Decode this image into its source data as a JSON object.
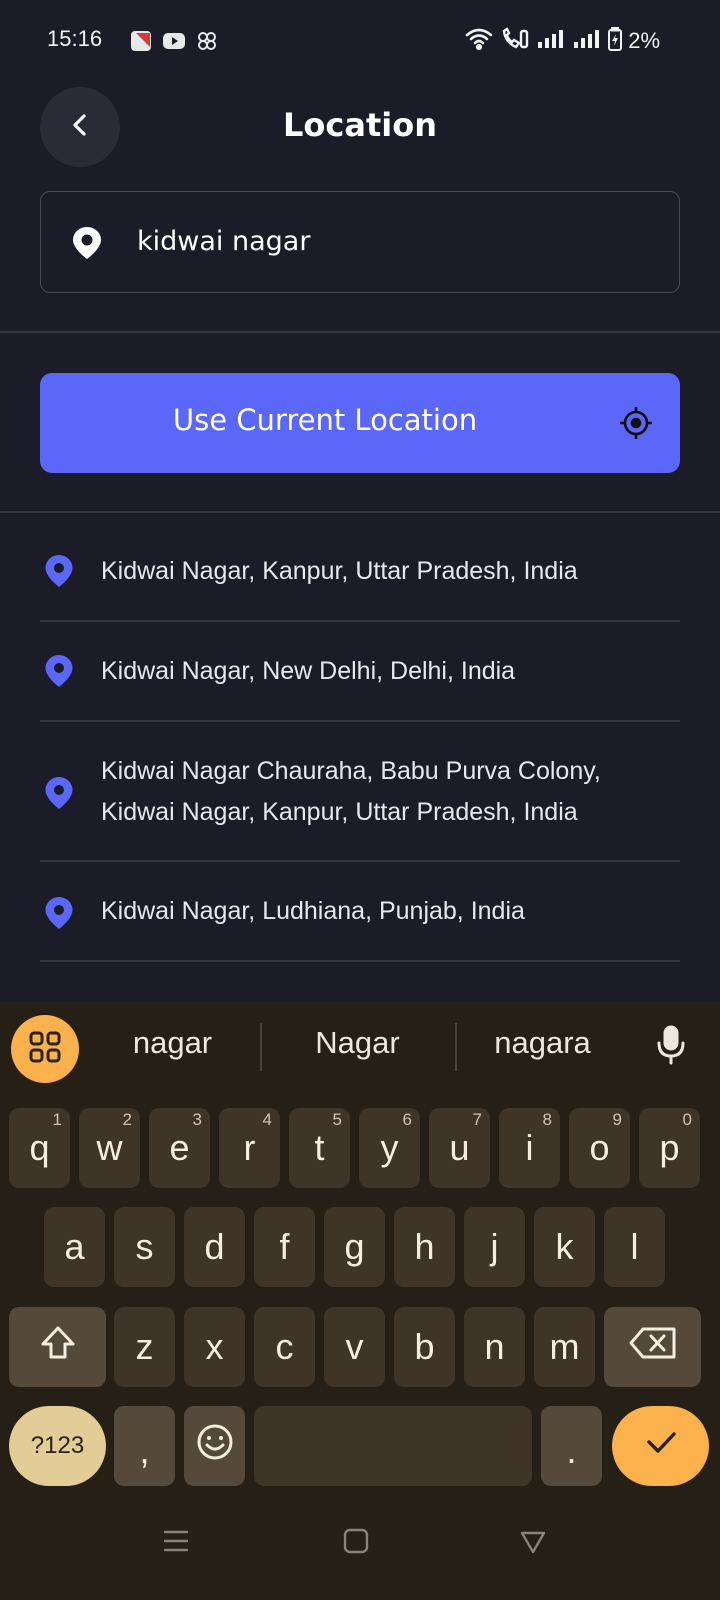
{
  "status_bar": {
    "time": "15:16",
    "battery": "2%"
  },
  "header": {
    "title": "Location"
  },
  "search": {
    "value": "kidwai nagar"
  },
  "current_location_button": {
    "label": "Use Current Location"
  },
  "results": [
    {
      "lines": [
        "Kidwai Nagar, Kanpur, Uttar Pradesh, India"
      ]
    },
    {
      "lines": [
        "Kidwai Nagar, New Delhi, Delhi, India"
      ]
    },
    {
      "lines": [
        "Kidwai Nagar Chauraha, Babu Purva Colony,",
        "Kidwai Nagar, Kanpur, Uttar Pradesh, India"
      ]
    },
    {
      "lines": [
        "Kidwai Nagar, Ludhiana, Punjab, India"
      ]
    }
  ],
  "keyboard": {
    "suggestions": [
      "nagar",
      "Nagar",
      "nagara"
    ],
    "row1": [
      {
        "k": "q",
        "h": "1"
      },
      {
        "k": "w",
        "h": "2"
      },
      {
        "k": "e",
        "h": "3"
      },
      {
        "k": "r",
        "h": "4"
      },
      {
        "k": "t",
        "h": "5"
      },
      {
        "k": "y",
        "h": "6"
      },
      {
        "k": "u",
        "h": "7"
      },
      {
        "k": "i",
        "h": "8"
      },
      {
        "k": "o",
        "h": "9"
      },
      {
        "k": "p",
        "h": "0"
      }
    ],
    "row2": [
      "a",
      "s",
      "d",
      "f",
      "g",
      "h",
      "j",
      "k",
      "l"
    ],
    "row3": [
      "z",
      "x",
      "c",
      "v",
      "b",
      "n",
      "m"
    ],
    "symbols_label": "?123",
    "comma": ",",
    "period": "."
  },
  "colors": {
    "background": "#1b1c28",
    "accent": "#5b67f8",
    "keyboard_accent": "#fbb24c"
  }
}
